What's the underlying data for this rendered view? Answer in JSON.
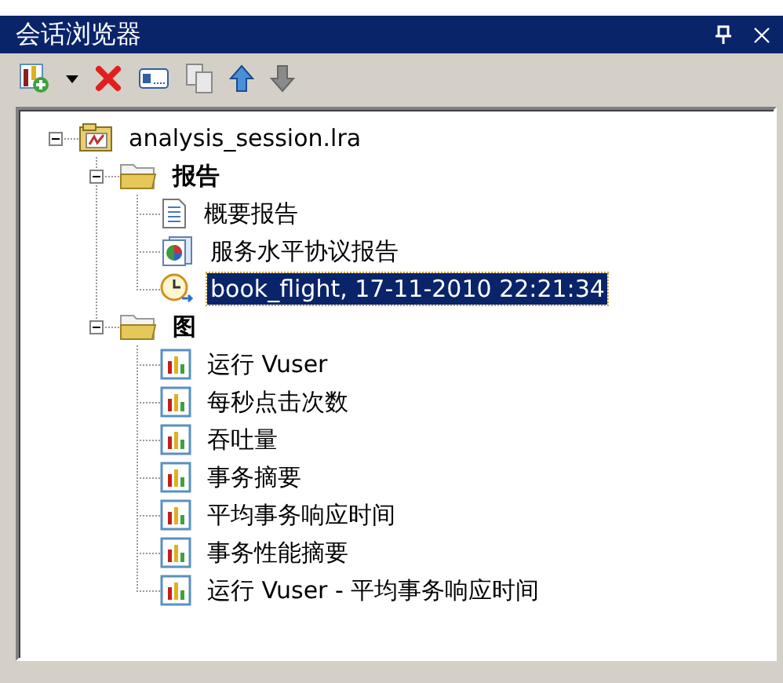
{
  "window": {
    "title": "会话浏览器"
  },
  "toolbar": [
    {
      "kind": "add-graph",
      "disabled": false
    },
    {
      "kind": "dropdown",
      "disabled": false
    },
    {
      "kind": "delete",
      "disabled": false
    },
    {
      "kind": "rename",
      "disabled": false
    },
    {
      "kind": "copy",
      "disabled": true
    },
    {
      "kind": "move-up",
      "disabled": false
    },
    {
      "kind": "move-down",
      "disabled": true
    }
  ],
  "tree": [
    {
      "kind": "session",
      "label": "analysis_session.lra",
      "expanded": true,
      "selected": false,
      "children": [
        {
          "kind": "folder",
          "label": "报告",
          "expanded": true,
          "selected": false,
          "children": [
            {
              "kind": "summary",
              "label": "概要报告",
              "selected": false
            },
            {
              "kind": "sla",
              "label": "服务水平协议报告",
              "selected": false
            },
            {
              "kind": "snapshot",
              "label": "book_flight, 17-11-2010 22:21:34",
              "selected": true
            }
          ]
        },
        {
          "kind": "folder",
          "label": "图",
          "expanded": true,
          "selected": false,
          "children": [
            {
              "kind": "graph",
              "label": "运行 Vuser",
              "selected": false
            },
            {
              "kind": "graph",
              "label": "每秒点击次数",
              "selected": false
            },
            {
              "kind": "graph",
              "label": "吞吐量",
              "selected": false
            },
            {
              "kind": "graph",
              "label": "事务摘要",
              "selected": false
            },
            {
              "kind": "graph",
              "label": "平均事务响应时间",
              "selected": false
            },
            {
              "kind": "graph",
              "label": "事务性能摘要",
              "selected": false
            },
            {
              "kind": "graph",
              "label": "运行 Vuser - 平均事务响应时间",
              "selected": false
            }
          ]
        }
      ]
    }
  ]
}
